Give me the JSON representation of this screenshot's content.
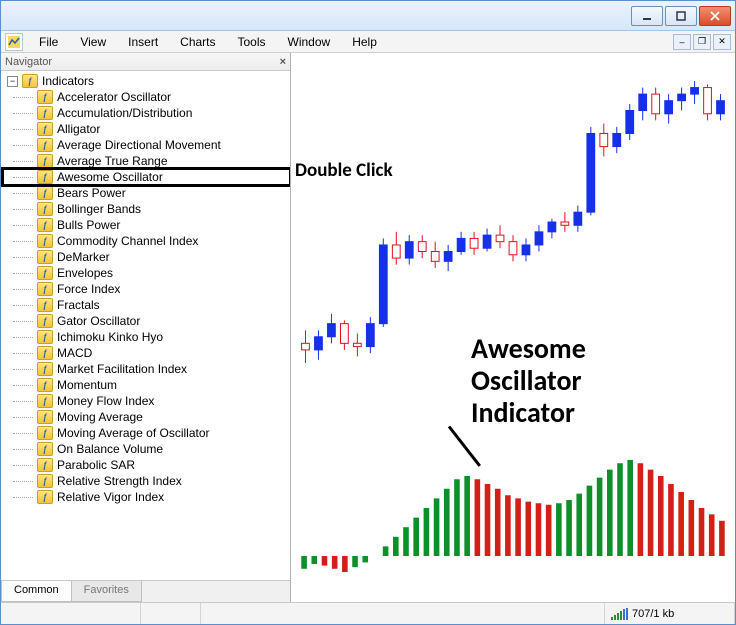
{
  "menu": {
    "items": [
      "File",
      "View",
      "Insert",
      "Charts",
      "Tools",
      "Window",
      "Help"
    ]
  },
  "navigator": {
    "title": "Navigator",
    "root_label": "Indicators",
    "items": [
      "Accelerator Oscillator",
      "Accumulation/Distribution",
      "Alligator",
      "Average Directional Movement",
      "Average True Range",
      "Awesome Oscillator",
      "Bears Power",
      "Bollinger Bands",
      "Bulls Power",
      "Commodity Channel Index",
      "DeMarker",
      "Envelopes",
      "Force Index",
      "Fractals",
      "Gator Oscillator",
      "Ichimoku Kinko Hyo",
      "MACD",
      "Market Facilitation Index",
      "Momentum",
      "Money Flow Index",
      "Moving Average",
      "Moving Average of Oscillator",
      "On Balance Volume",
      "Parabolic SAR",
      "Relative Strength Index",
      "Relative Vigor Index"
    ],
    "highlighted_index": 5,
    "tabs": {
      "active": "Common",
      "inactive": "Favorites"
    }
  },
  "annotations": {
    "double_click": "Double Click",
    "indicator_label": "Awesome\nOscillator\nIndicator"
  },
  "status": {
    "connection": "707/1 kb"
  },
  "chart_data": [
    {
      "type": "candlestick",
      "title": "",
      "xlabel": "",
      "ylabel": "",
      "series": [
        {
          "o": 100,
          "h": 104,
          "l": 94,
          "c": 98,
          "color": "red"
        },
        {
          "o": 98,
          "h": 104,
          "l": 95,
          "c": 102,
          "color": "blue"
        },
        {
          "o": 102,
          "h": 109,
          "l": 100,
          "c": 106,
          "color": "blue"
        },
        {
          "o": 106,
          "h": 107,
          "l": 98,
          "c": 100,
          "color": "red"
        },
        {
          "o": 100,
          "h": 103,
          "l": 96,
          "c": 99,
          "color": "red"
        },
        {
          "o": 99,
          "h": 108,
          "l": 97,
          "c": 106,
          "color": "blue"
        },
        {
          "o": 106,
          "h": 132,
          "l": 105,
          "c": 130,
          "color": "blue"
        },
        {
          "o": 130,
          "h": 134,
          "l": 124,
          "c": 126,
          "color": "red"
        },
        {
          "o": 126,
          "h": 133,
          "l": 124,
          "c": 131,
          "color": "blue"
        },
        {
          "o": 131,
          "h": 133,
          "l": 126,
          "c": 128,
          "color": "red"
        },
        {
          "o": 128,
          "h": 131,
          "l": 123,
          "c": 125,
          "color": "red"
        },
        {
          "o": 125,
          "h": 130,
          "l": 122,
          "c": 128,
          "color": "blue"
        },
        {
          "o": 128,
          "h": 134,
          "l": 127,
          "c": 132,
          "color": "blue"
        },
        {
          "o": 132,
          "h": 134,
          "l": 127,
          "c": 129,
          "color": "red"
        },
        {
          "o": 129,
          "h": 135,
          "l": 128,
          "c": 133,
          "color": "blue"
        },
        {
          "o": 133,
          "h": 136,
          "l": 129,
          "c": 131,
          "color": "red"
        },
        {
          "o": 131,
          "h": 133,
          "l": 125,
          "c": 127,
          "color": "red"
        },
        {
          "o": 127,
          "h": 132,
          "l": 125,
          "c": 130,
          "color": "blue"
        },
        {
          "o": 130,
          "h": 136,
          "l": 128,
          "c": 134,
          "color": "blue"
        },
        {
          "o": 134,
          "h": 138,
          "l": 132,
          "c": 137,
          "color": "blue"
        },
        {
          "o": 137,
          "h": 140,
          "l": 134,
          "c": 136,
          "color": "red"
        },
        {
          "o": 136,
          "h": 142,
          "l": 134,
          "c": 140,
          "color": "blue"
        },
        {
          "o": 140,
          "h": 166,
          "l": 139,
          "c": 164,
          "color": "blue"
        },
        {
          "o": 164,
          "h": 167,
          "l": 157,
          "c": 160,
          "color": "red"
        },
        {
          "o": 160,
          "h": 166,
          "l": 158,
          "c": 164,
          "color": "blue"
        },
        {
          "o": 164,
          "h": 173,
          "l": 162,
          "c": 171,
          "color": "blue"
        },
        {
          "o": 171,
          "h": 178,
          "l": 168,
          "c": 176,
          "color": "blue"
        },
        {
          "o": 176,
          "h": 178,
          "l": 168,
          "c": 170,
          "color": "red"
        },
        {
          "o": 170,
          "h": 176,
          "l": 167,
          "c": 174,
          "color": "blue"
        },
        {
          "o": 174,
          "h": 178,
          "l": 171,
          "c": 176,
          "color": "blue"
        },
        {
          "o": 176,
          "h": 180,
          "l": 173,
          "c": 178,
          "color": "blue"
        },
        {
          "o": 178,
          "h": 179,
          "l": 168,
          "c": 170,
          "color": "red"
        },
        {
          "o": 170,
          "h": 176,
          "l": 168,
          "c": 174,
          "color": "blue"
        }
      ]
    },
    {
      "type": "bar",
      "title": "Awesome Oscillator",
      "xlabel": "",
      "ylabel": "",
      "values": [
        -8,
        -5,
        -6,
        -8,
        -10,
        -7,
        -4,
        0,
        6,
        12,
        18,
        24,
        30,
        36,
        42,
        48,
        50,
        48,
        45,
        42,
        38,
        36,
        34,
        33,
        32,
        33,
        35,
        39,
        44,
        49,
        54,
        58,
        60,
        58,
        54,
        50,
        45,
        40,
        35,
        30,
        26,
        22
      ],
      "baseline": 0,
      "note": "Bar color green when value increases vs previous, red when decreases"
    }
  ]
}
